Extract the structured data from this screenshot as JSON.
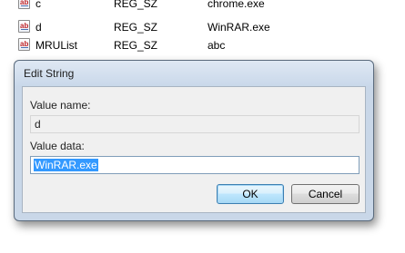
{
  "registry": {
    "rows": [
      {
        "name": "c",
        "type": "REG_SZ",
        "data": "chrome.exe"
      },
      {
        "name": "d",
        "type": "REG_SZ",
        "data": "WinRAR.exe"
      },
      {
        "name": "MRUList",
        "type": "REG_SZ",
        "data": "abc"
      }
    ]
  },
  "dialog": {
    "title": "Edit String",
    "value_name_label": "Value name:",
    "value_name": "d",
    "value_data_label": "Value data:",
    "value_data": "WinRAR.exe",
    "ok_label": "OK",
    "cancel_label": "Cancel"
  },
  "colors": {
    "selection": "#3399ff",
    "dialog_frame": "#c9d7e8",
    "client_bg": "#f0f0f0"
  },
  "icons": {
    "string_value": "reg-string-icon"
  }
}
